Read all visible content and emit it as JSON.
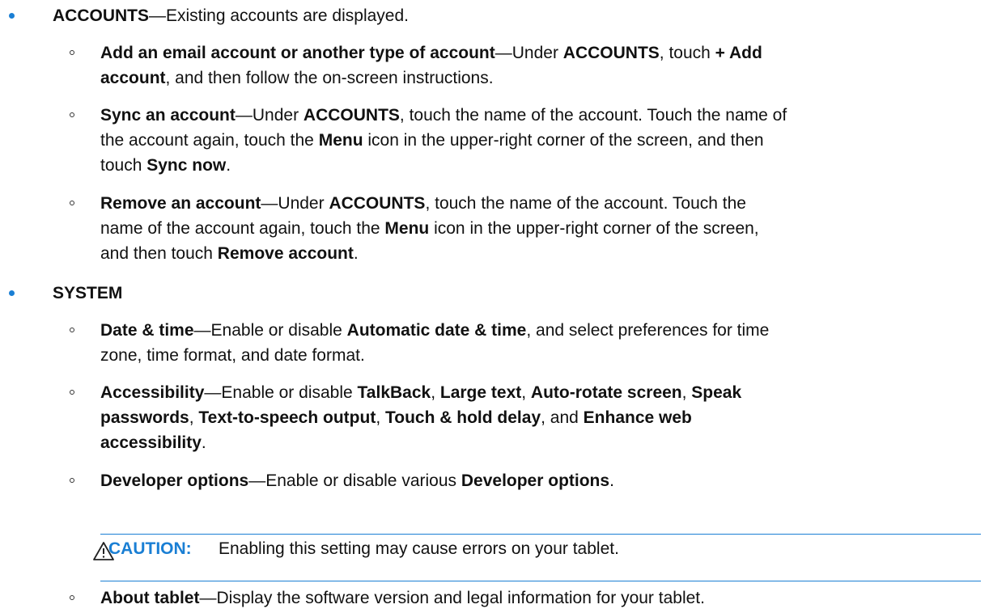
{
  "accounts": {
    "title": "ACCOUNTS",
    "desc": "—Existing accounts are displayed.",
    "add": {
      "term": "Add an email account or another type of account",
      "t1": "—Under ",
      "b1": "ACCOUNTS",
      "t2": ", touch ",
      "b2a": "+ Add",
      "b2b": "account",
      "t3": ", and then follow the on-screen instructions."
    },
    "sync": {
      "term": "Sync an account",
      "t1": "—Under ",
      "b1": "ACCOUNTS",
      "t2a": ", touch the name of the account. Touch the name of",
      "t2b": "the account again, touch the ",
      "b2": "Menu",
      "t3": " icon in the upper-right corner of the screen, and then",
      "t4": "touch ",
      "b3": "Sync now",
      "t5": "."
    },
    "remove": {
      "term": "Remove an account",
      "t1": "—Under ",
      "b1": "ACCOUNTS",
      "t2a": ", touch the name of the account. Touch the",
      "t2b": "name of the account again, touch the ",
      "b2": "Menu",
      "t3": " icon in the upper-right corner of the screen,",
      "t4": "and then touch ",
      "b3": "Remove account",
      "t5": "."
    }
  },
  "system": {
    "title": "SYSTEM",
    "datetime": {
      "term": "Date & time",
      "t1": "—Enable or disable ",
      "b1": "Automatic date & time",
      "t2a": ", and select preferences for time",
      "t2b": "zone, time format, and date format."
    },
    "accessibility": {
      "term": "Accessibility",
      "t1": "—Enable or disable ",
      "b1": "TalkBack",
      "c1": ", ",
      "b2": "Large text",
      "c2": ", ",
      "b3": "Auto-rotate screen",
      "c3": ", ",
      "b4a": "Speak",
      "b4b": "passwords",
      "c4": ", ",
      "b5": "Text-to-speech output",
      "c5": ", ",
      "b6": "Touch & hold delay",
      "c6": ", and ",
      "b7a": "Enhance web",
      "b7b": "accessibility",
      "t2": "."
    },
    "developer": {
      "term": "Developer options",
      "t1": "—Enable or disable various ",
      "b1": "Developer options",
      "t2": "."
    },
    "caution": {
      "label": "CAUTION:",
      "message": "Enabling this setting may cause errors on your tablet."
    },
    "about": {
      "term": "About tablet",
      "desc": "—Display the software version and legal information for your tablet."
    }
  },
  "colors": {
    "accent": "#1a7fd4",
    "text": "#111111"
  }
}
